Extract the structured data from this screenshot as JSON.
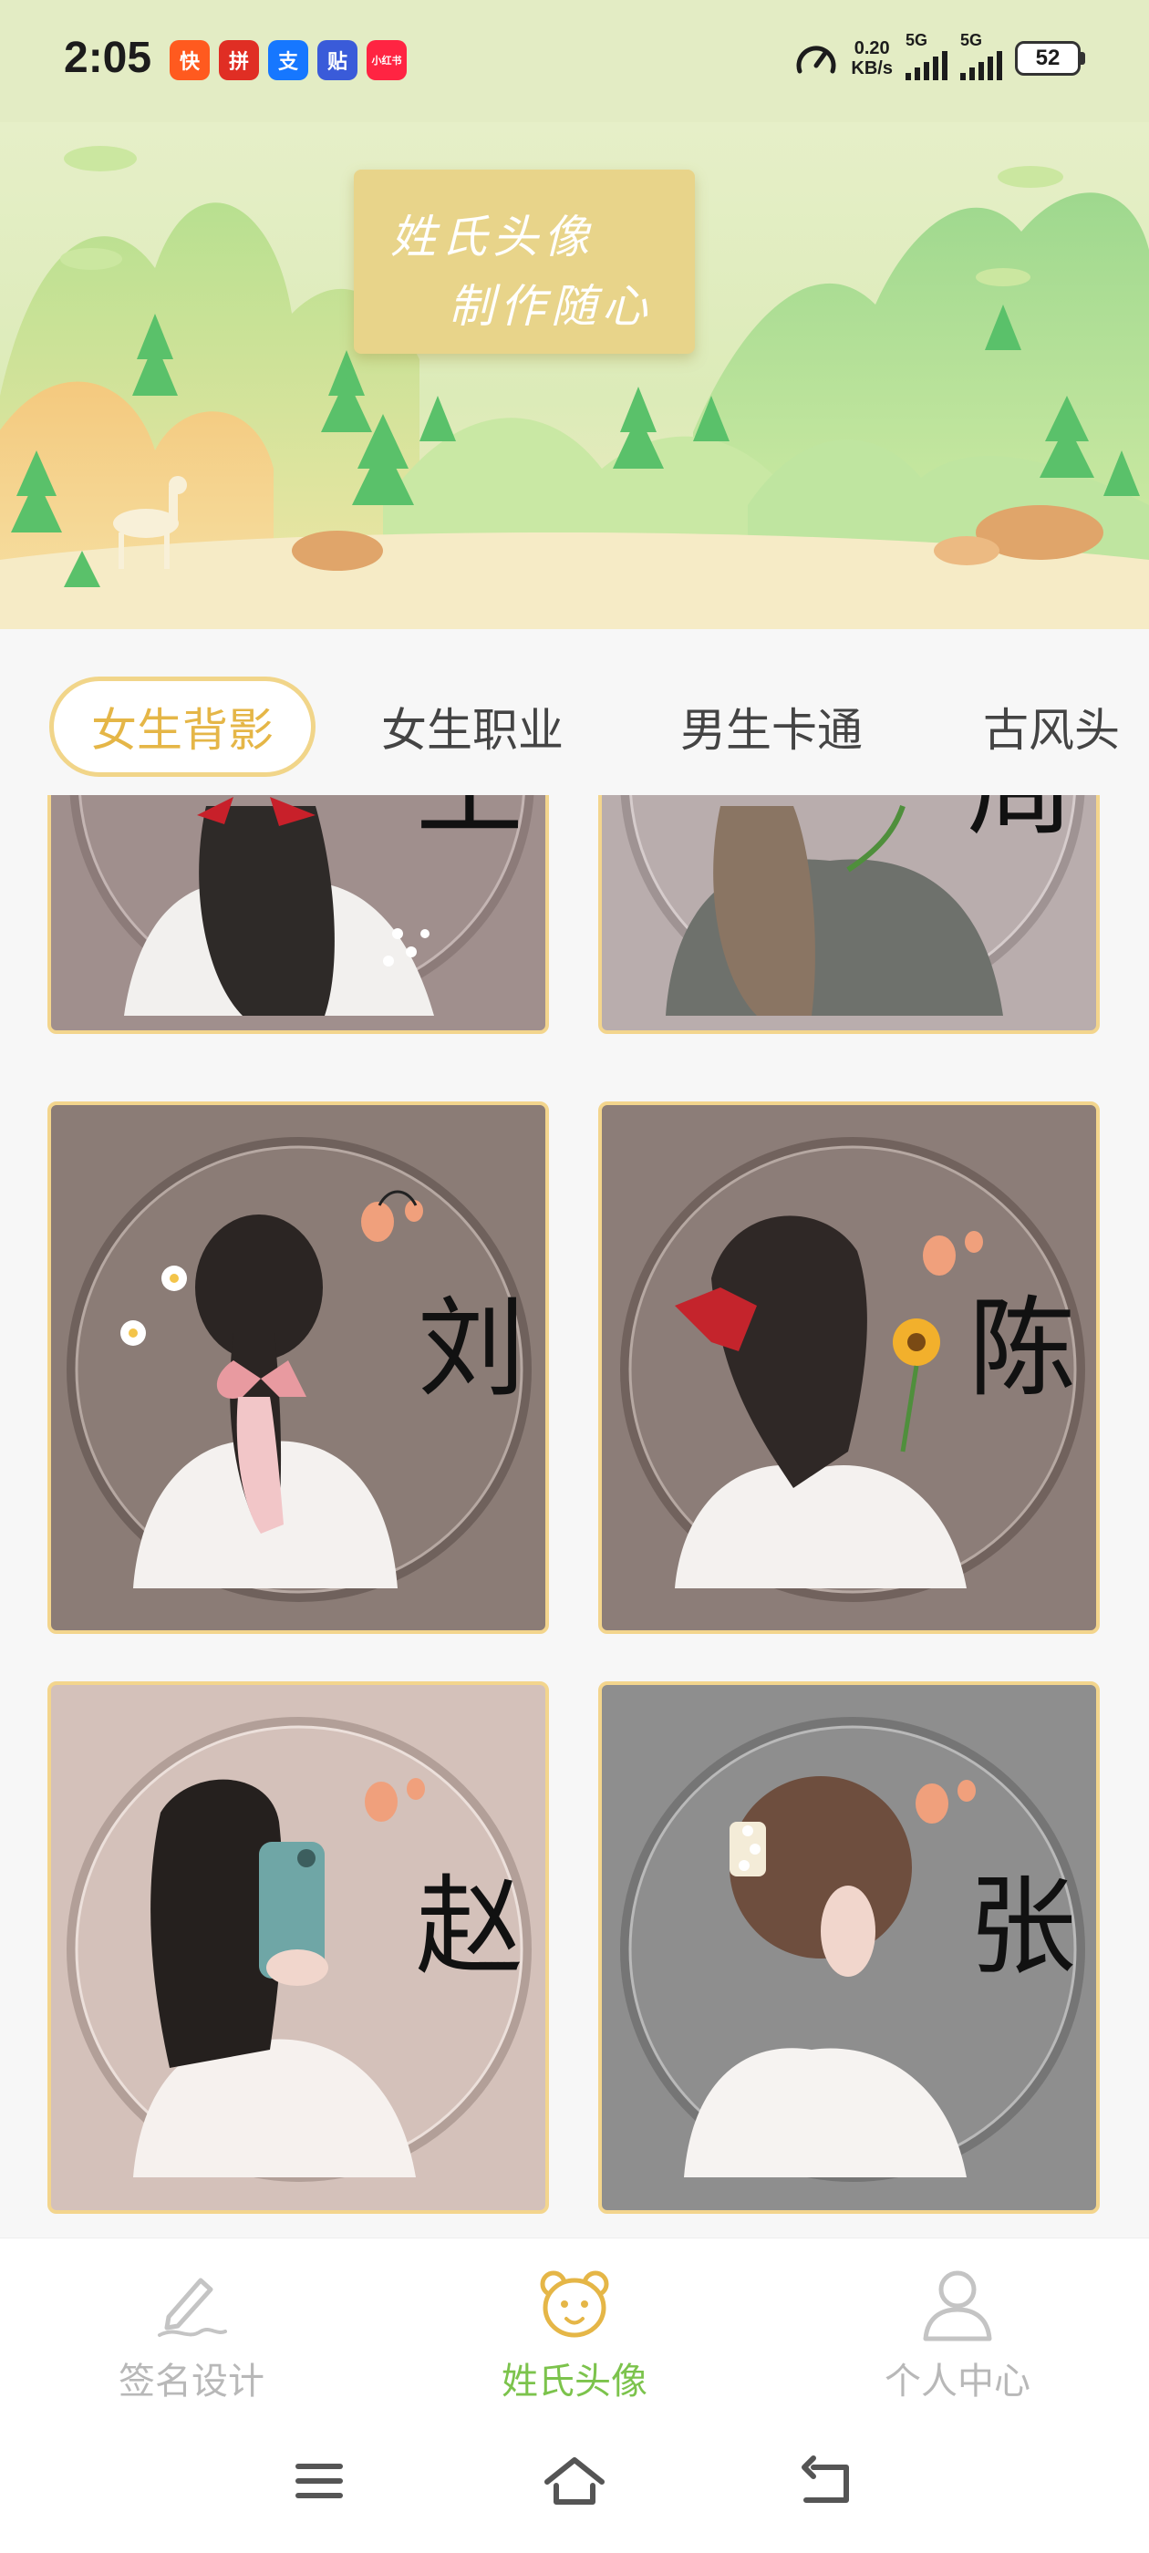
{
  "status_bar": {
    "time": "2:05",
    "notifications": [
      {
        "icon": "kuaishou-icon",
        "glyph": "快",
        "color": "#ff5a1f"
      },
      {
        "icon": "pinduoduo-icon",
        "glyph": "拼",
        "color": "#e02e24"
      },
      {
        "icon": "alipay-icon",
        "glyph": "支",
        "color": "#1677ff"
      },
      {
        "icon": "tieba-icon",
        "glyph": "贴",
        "color": "#3a5bd9"
      },
      {
        "icon": "xiaohongshu-icon",
        "glyph": "小红书",
        "color": "#ff2442"
      }
    ],
    "net_speed_value": "0.20",
    "net_speed_unit": "KB/s",
    "signal1_label": "5G",
    "signal2_label": "5G",
    "battery": "52"
  },
  "banner": {
    "line1": "姓氏头像",
    "line2": "制作随心"
  },
  "tabs": [
    {
      "label": "女生背影",
      "active": true
    },
    {
      "label": "女生职业",
      "active": false
    },
    {
      "label": "男生卡通",
      "active": false
    },
    {
      "label": "古风头",
      "active": false
    }
  ],
  "cards": [
    {
      "surname": "王",
      "bg": "#a08f8d",
      "accessory": "bow"
    },
    {
      "surname": "周",
      "bg": "#b9adad",
      "accessory": "sweater"
    },
    {
      "surname": "刘",
      "bg": "#8b7c76",
      "accessory": "scarf"
    },
    {
      "surname": "陈",
      "bg": "#8c7d78",
      "accessory": "bow"
    },
    {
      "surname": "赵",
      "bg": "#d4c1ba",
      "accessory": "phone"
    },
    {
      "surname": "张",
      "bg": "#8e8e8e",
      "accessory": "clip"
    }
  ],
  "bottom_nav": [
    {
      "label": "签名设计",
      "icon": "signature-pen-icon",
      "active": false
    },
    {
      "label": "姓氏头像",
      "icon": "bear-face-icon",
      "active": true
    },
    {
      "label": "个人中心",
      "icon": "person-icon",
      "active": false
    }
  ],
  "colors": {
    "accent": "#e5b647",
    "nav_active": "#7cc34c",
    "card_border": "#f3d58d"
  }
}
